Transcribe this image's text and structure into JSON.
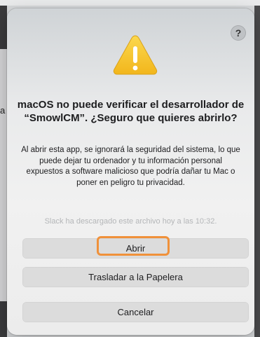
{
  "dialog": {
    "help_label": "?",
    "title": "macOS no puede verificar el desarrollador de “SmowlCM”. ¿Seguro que quieres abrirlo?",
    "message": "Al abrir esta app, se ignorará la seguridad del sistema, lo que puede dejar tu ordenador y tu información personal expuestos a software malicioso que podría dañar tu Mac o poner en peligro tu privacidad.",
    "source_note": "Slack ha descargado este archivo hoy a las 10:32.",
    "buttons": {
      "open": "Abrir",
      "trash": "Trasladar a la Papelera",
      "cancel": "Cancelar"
    },
    "icon": "warning-triangle-icon",
    "colors": {
      "warning_yellow": "#f7c42b",
      "highlight_orange": "#f0913a"
    }
  },
  "background": {
    "left_edge_char": "a"
  }
}
